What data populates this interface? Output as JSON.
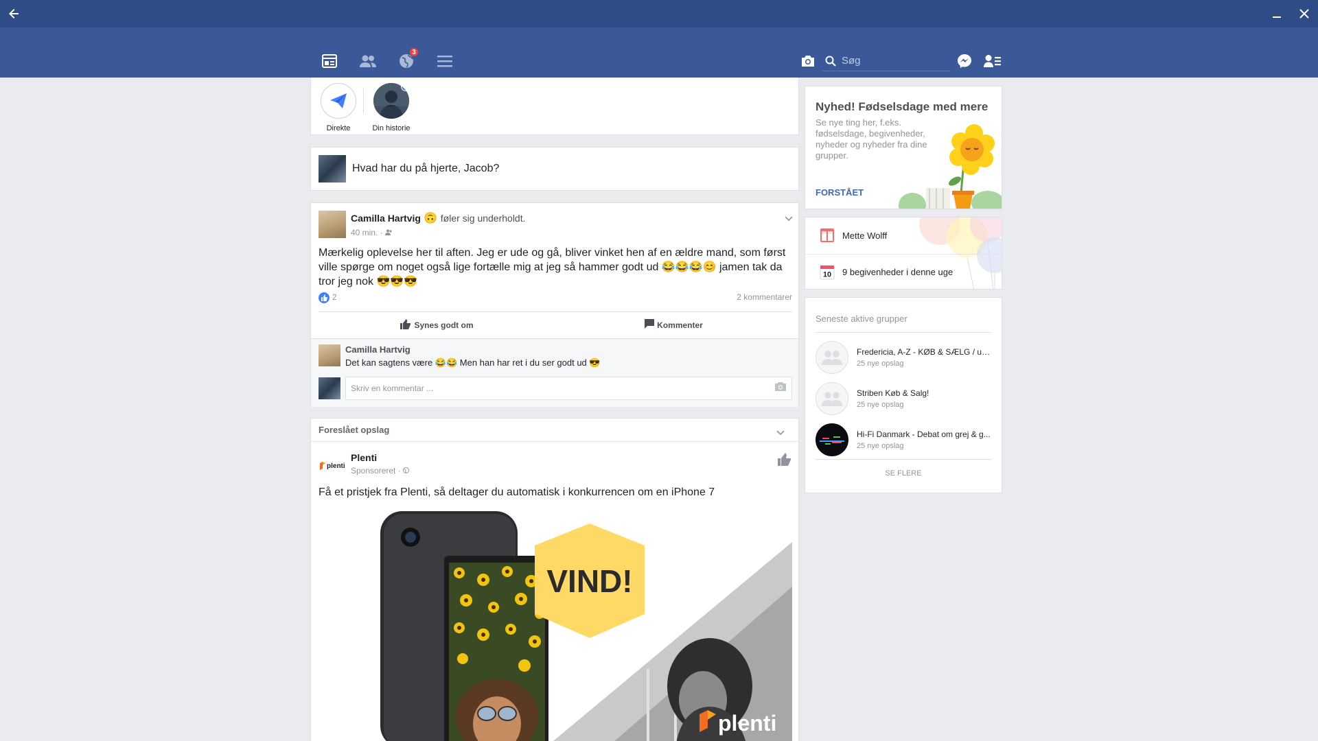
{
  "nav": {
    "search_placeholder": "Søg",
    "notification_count": "3"
  },
  "stories": {
    "direct_label": "Direkte",
    "own_story_label": "Din historie"
  },
  "composer": {
    "prompt": "Hvad har du på hjerte, Jacob?"
  },
  "post": {
    "author": "Camilla Hartvig",
    "feeling": "føler sig underholdt.",
    "time": "40 min. ·",
    "body": "Mærkelig oplevelse her til aften. Jeg er ude og gå, bliver vinket hen af en ældre mand, som først ville spørge om noget også lige fortælle mig at jeg så hammer godt ud 😂😂😂😊 jamen tak da tror jeg nok 😎😎😎",
    "like_count": "2",
    "comment_count": "2 kommentarer",
    "like_action": "Synes godt om",
    "comment_action": "Kommenter",
    "comment": {
      "author": "Camilla Hartvig",
      "text": "Det kan sagtens være 😂😂 Men han har ret i du ser godt ud 😎"
    },
    "reply_placeholder": "Skriv en kommentar ..."
  },
  "suggested": {
    "header": "Foreslået opslag",
    "advertiser": "Plenti",
    "sponsored": "Sponsoreret ·",
    "text": "Få et pristjek fra Plenti, så deltager du automatisk i konkurrencen om en iPhone 7",
    "image_headline": "VIND!",
    "image_brand": "plenti"
  },
  "promo": {
    "title": "Nyhed! Fødselsdage med mere",
    "body": "Se nye ting her, f.eks. fødselsdage, begivenheder, nyheder og nyheder fra dine grupper.",
    "cta": "FORSTÅET"
  },
  "events": {
    "birthday": "Mette Wolff",
    "calendar_day": "10",
    "events_text": "9 begivenheder i denne uge"
  },
  "groups": {
    "title": "Seneste aktive grupper",
    "items": [
      {
        "name": "Fredericia, A-Z - KØB & SÆLG / ude...",
        "count": "25 nye opslag"
      },
      {
        "name": "Striben Køb & Salg!",
        "count": "25 nye opslag"
      },
      {
        "name": "Hi-Fi Danmark - Debat om grej & g...",
        "count": "25 nye opslag"
      }
    ],
    "see_more": "SE FLERE"
  },
  "colors": {
    "brand": "#3b5998",
    "titlebar": "#2f4c86",
    "accent": "#4267b2",
    "background": "#e9ebee"
  },
  "icons": [
    "back-arrow-icon",
    "minimize-icon",
    "close-icon",
    "news-feed-icon",
    "friends-icon",
    "notifications-globe-icon",
    "menu-icon",
    "camera-icon",
    "search-icon",
    "messenger-icon",
    "friend-requests-icon",
    "paper-plane-icon",
    "chevron-down-icon",
    "thumbs-up-icon",
    "comment-icon",
    "camera-small-icon",
    "globe-icon",
    "gift-icon",
    "calendar-icon",
    "group-icon"
  ]
}
